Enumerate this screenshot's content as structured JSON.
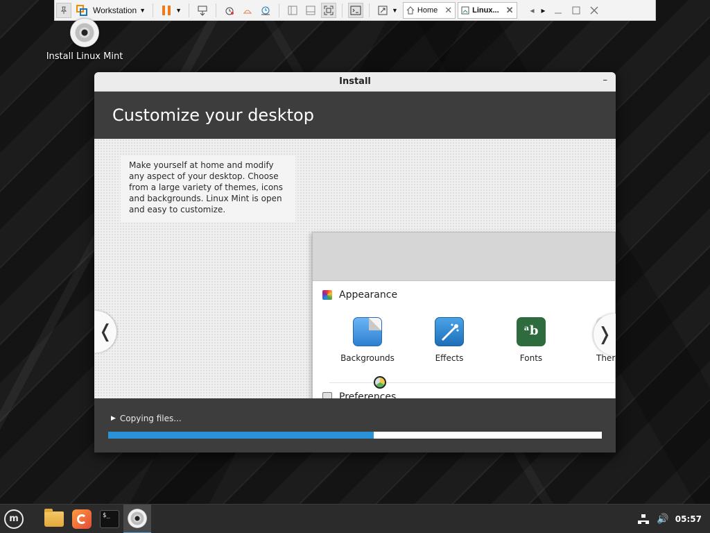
{
  "vm_toolbar": {
    "library_label": "Workstation",
    "tabs": [
      {
        "label": "Home",
        "active": false
      },
      {
        "label": "Linux...",
        "active": true
      }
    ]
  },
  "desktop": {
    "icons": [
      {
        "label": "Install Linux Mint"
      }
    ]
  },
  "installer": {
    "window_title": "Install",
    "minimize_glyph": "–",
    "heading": "Customize your desktop",
    "slide_text": "Make yourself at home and modify any aspect of your desktop. Choose from a large variety of themes, icons and backgrounds. Linux Mint is open and easy to customize.",
    "prev_glyph": "❬",
    "next_glyph": "❭",
    "settings": {
      "sections": [
        {
          "title": "Appearance",
          "icon": "appearance-icon"
        },
        {
          "title": "Preferences",
          "icon": "preferences-icon"
        }
      ],
      "appearance_items": [
        {
          "label": "Backgrounds",
          "icon": "backgrounds-icon"
        },
        {
          "label": "Effects",
          "icon": "effects-icon"
        },
        {
          "label": "Fonts",
          "icon": "fonts-icon"
        },
        {
          "label": "Ther",
          "icon": "themes-icon"
        }
      ],
      "fonts_icon_glyph": "ᵃb",
      "preferences_items": [
        {
          "icon": "accessibility-icon"
        },
        {
          "icon": "account-details-icon"
        },
        {
          "icon": "applets-icon"
        },
        {
          "icon": "date-time-icon"
        }
      ]
    },
    "progress": {
      "label": "Copying files...",
      "percent": 53.8,
      "fill_color": "#2b92d6"
    }
  },
  "taskbar": {
    "launchers": [
      {
        "name": "menu",
        "icon": "mint-logo-icon"
      },
      {
        "name": "files",
        "icon": "folder-icon"
      },
      {
        "name": "firefox",
        "icon": "firefox-icon"
      },
      {
        "name": "terminal",
        "icon": "terminal-icon",
        "glyph": "$_"
      },
      {
        "name": "installer",
        "icon": "disc-icon",
        "active": true
      }
    ],
    "tray": {
      "clock": "05:57",
      "icons": [
        "network-icon",
        "volume-icon"
      ]
    }
  },
  "colors": {
    "accent": "#2b92d6",
    "window_dark": "#3d3d3d",
    "titlebar": "#ececec"
  }
}
